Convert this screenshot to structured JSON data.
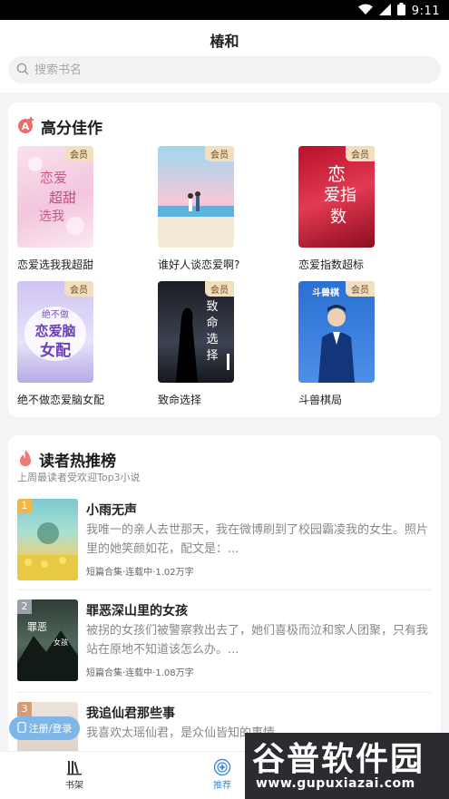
{
  "status_bar": {
    "time": "9:11"
  },
  "header": {
    "title": "椿和",
    "search_placeholder": "搜索书名"
  },
  "section_top": {
    "title": "高分佳作",
    "vip_label": "会员",
    "books": [
      {
        "name": "恋爱选我我超甜",
        "cover_text": "恋爱选我 我超甜"
      },
      {
        "name": "谁好人谈恋爱啊?",
        "cover_text": ""
      },
      {
        "name": "恋爱指数超标",
        "cover_text": "恋爱指数 超标"
      },
      {
        "name": "绝不做恋爱脑女配",
        "cover_text": "绝不做 恋爱脑 女配"
      },
      {
        "name": "致命选择",
        "cover_text": "致命选择"
      },
      {
        "name": "斗兽棋局",
        "cover_text": "斗兽棋局"
      }
    ]
  },
  "section_rank": {
    "title": "读者热推榜",
    "subtitle": "上周最读者受欢迎Top3小说",
    "items": [
      {
        "rank": "1",
        "title": "小雨无声",
        "desc": "我唯一的亲人去世那天，我在微博刷到了校园霸凌我的女生。照片里的她笑颜如花，配文是：...",
        "meta": "短篇合集·连载中·1.02万字"
      },
      {
        "rank": "2",
        "title": "罪恶深山里的女孩",
        "desc": "被拐的女孩们被警察救出去了，她们喜极而泣和家人团聚，只有我站在原地不知道该怎么办。...",
        "meta": "短篇合集·连载中·1.08万字"
      },
      {
        "rank": "3",
        "title": "我追仙君那些事",
        "desc": "我喜欢太瑶仙君，是众仙皆知的事情，",
        "meta": ""
      }
    ]
  },
  "login_button": "注册/登录",
  "tabs": [
    {
      "label": "书架",
      "icon": "bookshelf-icon"
    },
    {
      "label": "推荐",
      "icon": "recommend-icon",
      "active": true
    }
  ],
  "watermark": {
    "text": "谷普软件园",
    "url": "www.gupuxiazai.com"
  },
  "colors": {
    "accent": "#3c8cde",
    "vip_bg": "#f2dfc0",
    "rank_icon": "#f06a6a"
  }
}
